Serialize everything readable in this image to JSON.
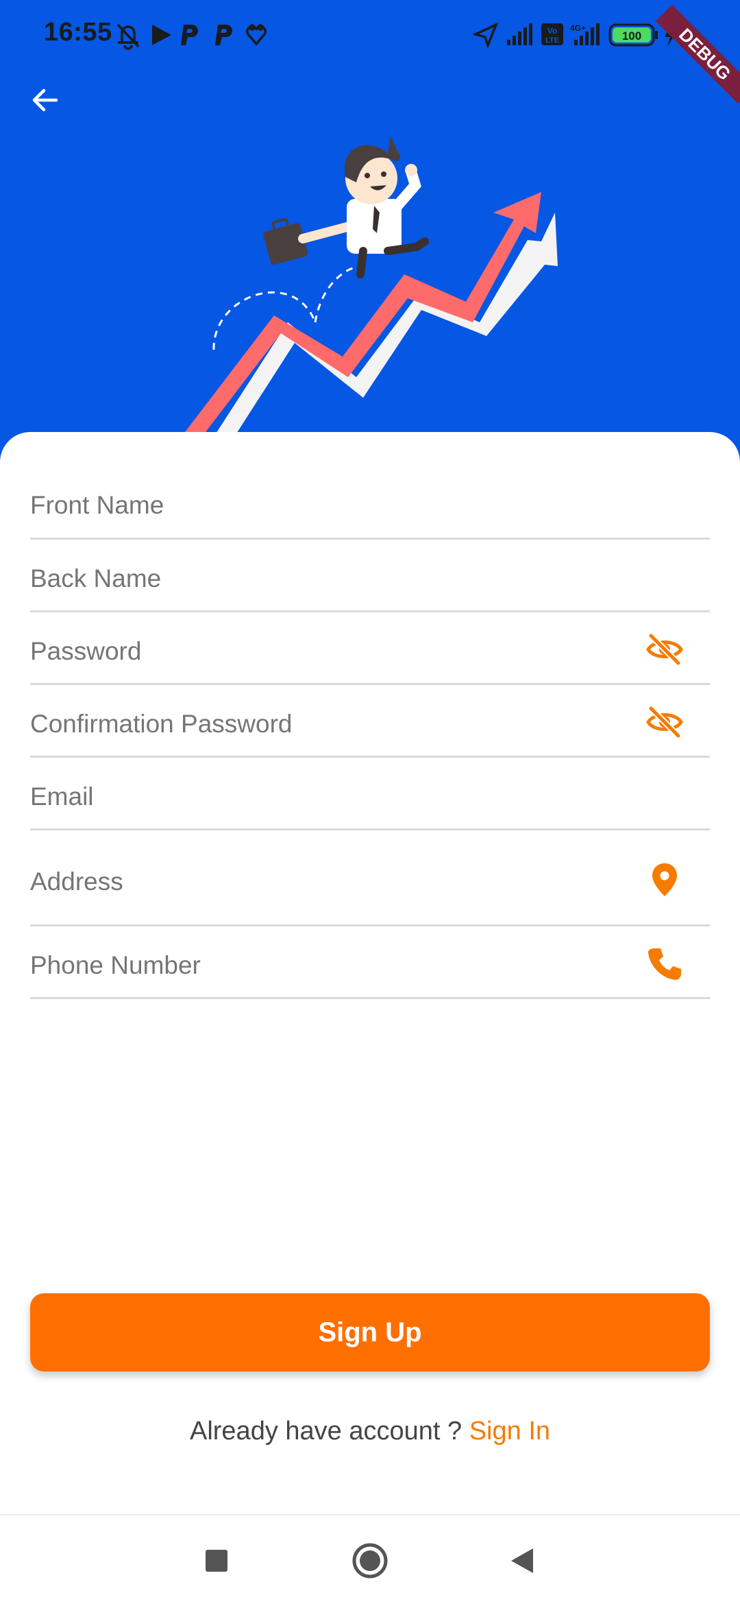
{
  "status_bar": {
    "time": "16:55",
    "battery": "100",
    "network": "4G+",
    "icons_left": [
      "bell-off-icon",
      "play-icon",
      "p-icon",
      "p-icon",
      "heart-icon"
    ],
    "icons_right": [
      "location-icon",
      "signal-icon",
      "volte-icon",
      "signal-icon",
      "battery-icon",
      "charging-icon"
    ]
  },
  "debug_banner": "DEBUG",
  "header": {
    "back_icon": "arrow-left-icon",
    "illustration": "businessman-on-growth-arrow"
  },
  "form": {
    "fields": [
      {
        "placeholder": "Front Name"
      },
      {
        "placeholder": "Back Name"
      },
      {
        "placeholder": "Password",
        "icon": "eye-off-icon"
      },
      {
        "placeholder": "Confirmation Password",
        "icon": "eye-off-icon"
      },
      {
        "placeholder": "Email"
      },
      {
        "placeholder": "Address",
        "icon": "location-pin-icon"
      },
      {
        "placeholder": "Phone Number",
        "icon": "phone-icon"
      }
    ],
    "submit_label": "Sign Up"
  },
  "footer": {
    "prompt": "Already have account ?",
    "link": "Sign In"
  },
  "colors": {
    "header_bg": "#0557E4",
    "accent": "#FF6F00",
    "link": "#F57C00",
    "arrow": "#FF6B6B"
  },
  "nav_bar": {
    "buttons": [
      "recent-apps-icon",
      "home-icon",
      "back-triangle-icon"
    ]
  }
}
